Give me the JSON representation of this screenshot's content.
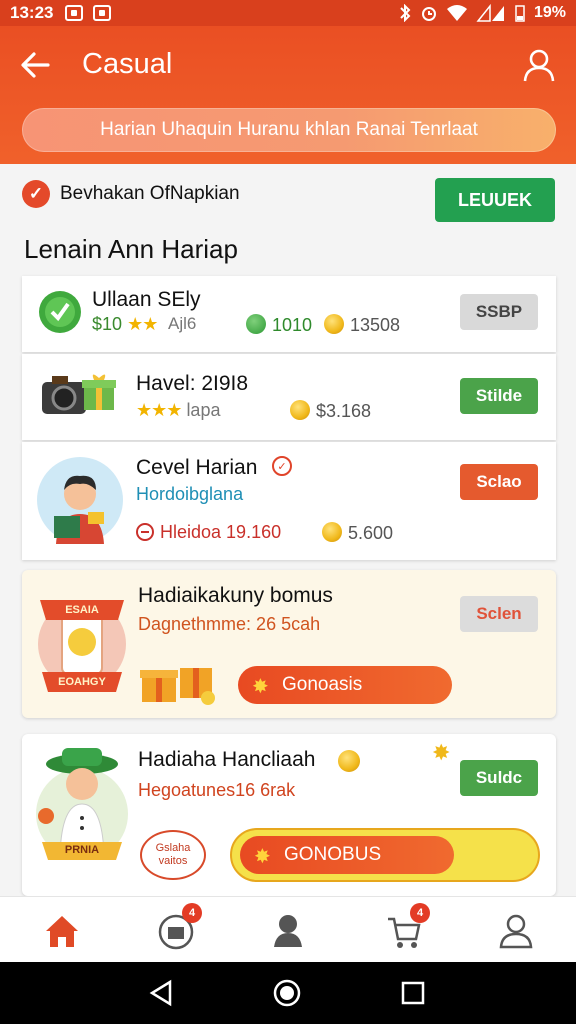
{
  "status_bar": {
    "time": "13:23",
    "battery": "19%"
  },
  "app_bar": {
    "title": "Casual",
    "banner_text": "Harian Uhaquin Huranu khlan Ranai Tenrlaat"
  },
  "check_row": {
    "label": "Bevhakan OfNapkian",
    "button": "LEUUEK"
  },
  "section": {
    "title": "Lenain Ann Hariap"
  },
  "cards": [
    {
      "title": "Ullaan SEly",
      "price": "$10",
      "sub": "Ajl6",
      "gem_value": "1010",
      "coin_value": "13508",
      "button": "SSBP"
    },
    {
      "title": "Havel: 2I9I8",
      "sub": "lapa",
      "coin_value": "$3.168",
      "button": "Stilde"
    },
    {
      "title": "Cevel Harian",
      "subtitle": "Hordoibglana",
      "timer": "Hleidoa 19.160",
      "coin_value": "5.600",
      "button": "Sclao"
    },
    {
      "title": "Hadiaikakuny bomus",
      "subtitle": "Dagnethmme: 26 5cah",
      "button": "Sclen",
      "bonus": "Gonoasis",
      "badge_top": "ESAIA",
      "badge_bottom": "EOAHGY"
    },
    {
      "title": "Hadiaha Hancliaah",
      "subtitle": "Hegoatunes16 6rak",
      "button": "Suldc",
      "bonus": "GONOBUS",
      "bubble": "Gslaha vaitos",
      "ribbon": "PRNIA"
    }
  ],
  "colors": {
    "primary": "#ea4f23",
    "green": "#23a050",
    "star": "#f2b400"
  },
  "nav": {
    "items": [
      {
        "icon": "home-icon"
      },
      {
        "icon": "store-icon",
        "badge": "4"
      },
      {
        "icon": "avatar-icon"
      },
      {
        "icon": "cart-icon",
        "badge": "4"
      },
      {
        "icon": "profile-icon"
      }
    ]
  }
}
